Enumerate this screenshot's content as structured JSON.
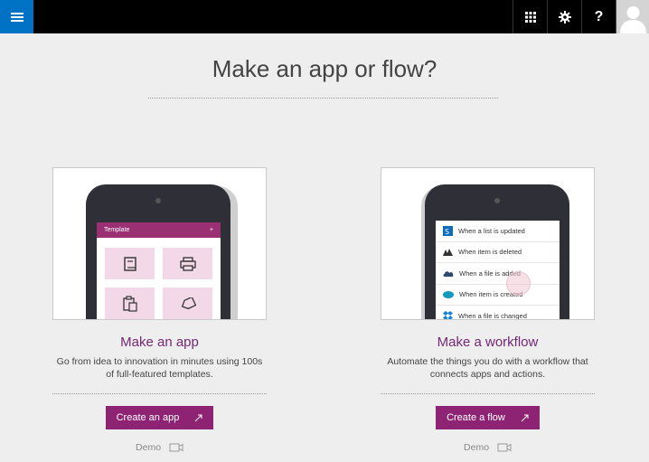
{
  "header": {
    "menu_icon": "hamburger-icon",
    "icons": [
      "app-launcher-icon",
      "gear-icon",
      "help-icon"
    ],
    "help_label": "?",
    "avatar": "user-avatar-icon",
    "colors": {
      "bar": "#000000",
      "menu_button": "#0072c6"
    }
  },
  "page": {
    "title": "Make an app or flow?"
  },
  "cards": {
    "app": {
      "title": "Make an app",
      "description": "Go from idea to innovation in minutes using 100s of full-featured templates.",
      "button_label": "Create an app",
      "demo_label": "Demo",
      "preview": {
        "header_label": "Template",
        "add_label": "+"
      }
    },
    "flow": {
      "title": "Make a workflow",
      "description": "Automate the things you do with a workflow that connects apps and actions.",
      "button_label": "Create a flow",
      "demo_label": "Demo",
      "preview": {
        "items": [
          "When a list is updated",
          "When item is deleted",
          "When a file is added",
          "When item is created",
          "When a file is changed"
        ]
      }
    }
  },
  "colors": {
    "accent": "#8f2373",
    "title": "#742774"
  }
}
